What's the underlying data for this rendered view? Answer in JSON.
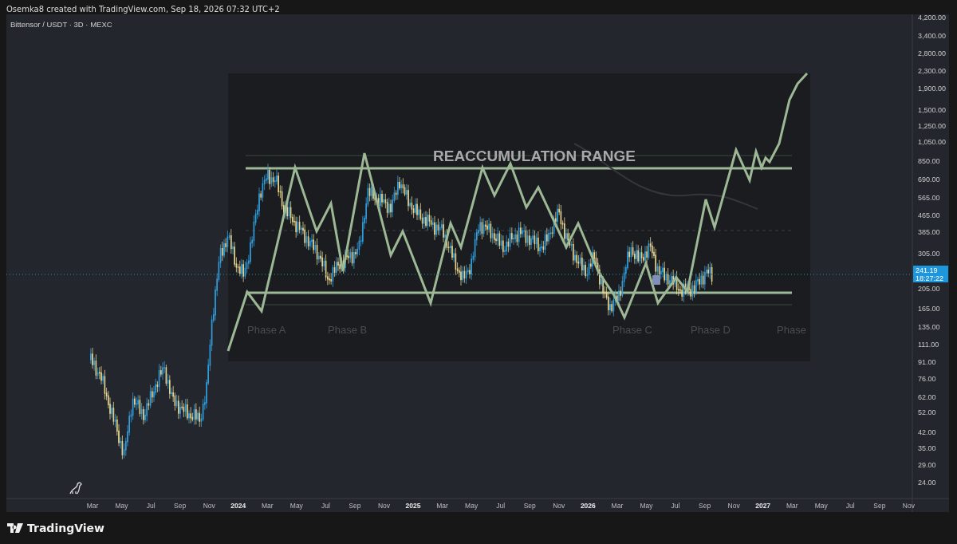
{
  "header": {
    "text": "Osemka8 created with TradingView.com, Sep 18, 2026 07:32 UTC+2"
  },
  "chart": {
    "symbol": "Bittensor / USDT · 3D · MEXC",
    "price_axis": {
      "labels": [
        "4,200.00",
        "3,400.00",
        "2,800.00",
        "2,300.00",
        "1,900.00",
        "1,500.00",
        "1,250.00",
        "1,050.00",
        "850.00",
        "690.00",
        "565.00",
        "465.00",
        "385.00",
        "305.00",
        "205.00",
        "165.00",
        "135.00",
        "111.00",
        "91.00",
        "76.00",
        "62.00",
        "52.00",
        "42.00",
        "35.00",
        "29.00",
        "24.00"
      ]
    },
    "last_price": {
      "price": "241.19",
      "countdown": "18:27:22"
    },
    "time_axis": {
      "labels": [
        "Mar",
        "May",
        "Jul",
        "Sep",
        "Nov",
        "2024",
        "Mar",
        "May",
        "Jul",
        "Sep",
        "Nov",
        "2025",
        "Mar",
        "May",
        "Jul",
        "Sep",
        "Nov",
        "2026",
        "Mar",
        "May",
        "Jul",
        "Sep",
        "Nov",
        "2027",
        "Mar",
        "May",
        "Jul",
        "Sep",
        "Nov"
      ]
    },
    "overlay_image": {
      "title": "REACCUMULATION RANGE",
      "phases": [
        "Phase A",
        "Phase B",
        "Phase C",
        "Phase D",
        "Phase"
      ]
    }
  },
  "footer": {
    "brand": "TradingView"
  }
}
